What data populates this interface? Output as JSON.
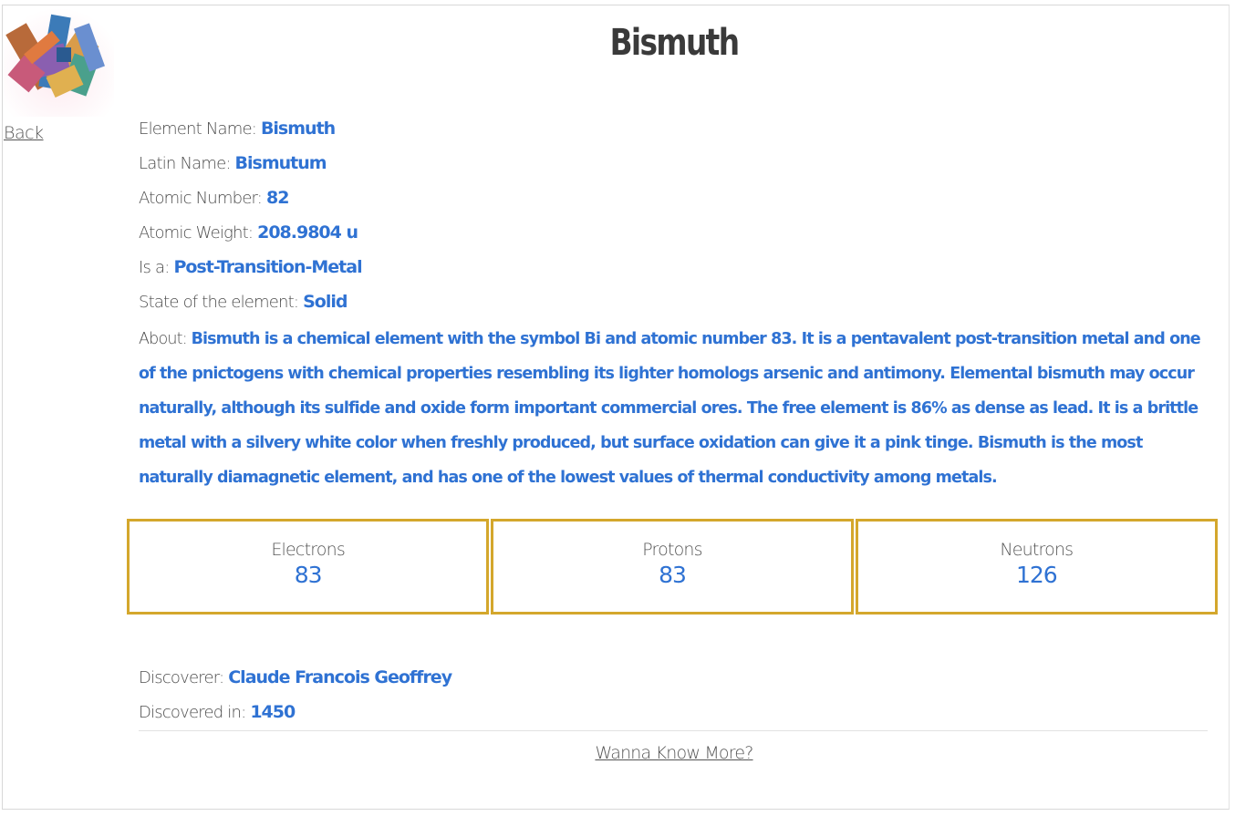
{
  "nav": {
    "back_label": "Back",
    "more_label": "Wanna Know More?"
  },
  "element": {
    "title": "Bismuth",
    "fields": [
      {
        "label": "Element Name: ",
        "value": "Bismuth"
      },
      {
        "label": "Latin Name: ",
        "value": "Bismutum"
      },
      {
        "label": "Atomic Number: ",
        "value": "82"
      },
      {
        "label": "Atomic Weight: ",
        "value": "208.9804 u"
      },
      {
        "label": "Is a: ",
        "value": "Post-Transition-Metal"
      },
      {
        "label": "State of the element: ",
        "value": "Solid"
      }
    ],
    "about": {
      "label": "About: ",
      "value": "Bismuth is a chemical element with the symbol Bi and atomic number 83. It is a pentavalent post-transition metal and one of the pnictogens with chemical properties resembling its lighter homologs arsenic and antimony. Elemental bismuth may occur naturally, although its sulfide and oxide form important commercial ores. The free element is 86% as dense as lead. It is a brittle metal with a silvery white color when freshly produced, but surface oxidation can give it a pink tinge. Bismuth is the most naturally diamagnetic element, and has one of the lowest values of thermal conductivity among metals."
    }
  },
  "particles": [
    {
      "label": "Electrons",
      "value": "83"
    },
    {
      "label": "Protons",
      "value": "83"
    },
    {
      "label": "Neutrons",
      "value": "126"
    }
  ],
  "discovery": {
    "discoverer_label": "Discoverer: ",
    "discoverer_value": "Claude Francois Geoffrey",
    "year_label": "Discovered in: ",
    "year_value": "1450"
  },
  "colors": {
    "accent_value": "#2f72d3",
    "box_border": "#d4a72c",
    "text_label": "#4d4d4d"
  }
}
